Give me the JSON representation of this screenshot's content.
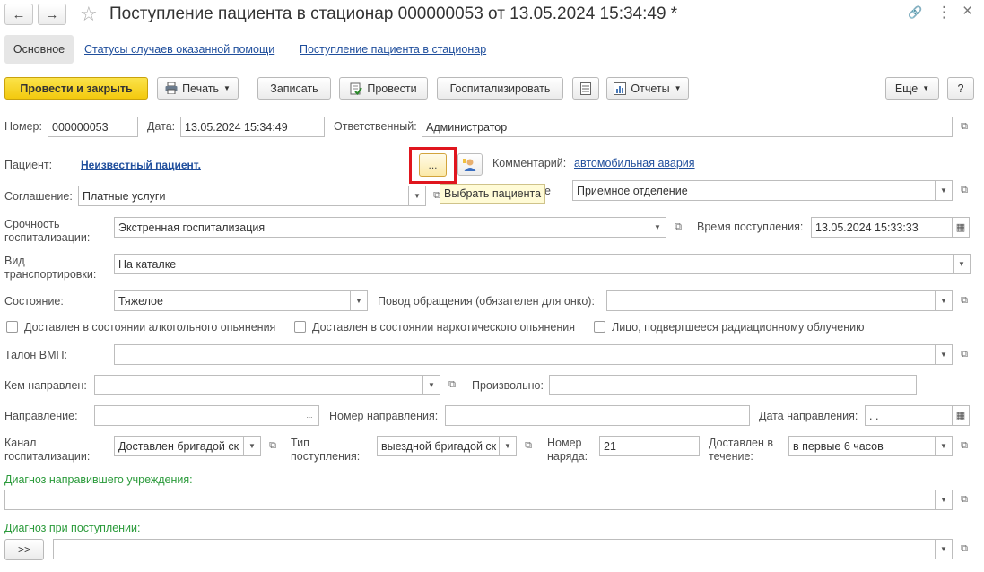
{
  "window": {
    "title": "Поступление пациента в стационар 000000053 от 13.05.2024 15:34:49 *",
    "back_glyph": "←",
    "forward_glyph": "→",
    "star_glyph": "☆",
    "link_glyph": "🔗",
    "more_glyph": "⋮",
    "close_glyph": "×"
  },
  "tabs": {
    "main": "Основное",
    "statuses": "Статусы случаев оказанной помощи",
    "admission": "Поступление пациента в стационар"
  },
  "toolbar": {
    "post_close": "Провести и закрыть",
    "print": "Печать",
    "write": "Записать",
    "post": "Провести",
    "hospitalize": "Госпитализировать",
    "reports": "Отчеты",
    "more": "Еще",
    "help": "?"
  },
  "form": {
    "number_label": "Номер:",
    "number_value": "000000053",
    "date_label": "Дата:",
    "date_value": "13.05.2024 15:34:49",
    "responsible_label": "Ответственный:",
    "responsible_value": "Администратор",
    "patient_label": "Пациент:",
    "patient_value": "Неизвестный пациент.",
    "select_button": "...",
    "tooltip": "Выбрать пациента",
    "comment_label": "Комментарий:",
    "comment_value": "автомобильная авария",
    "agreement_label": "Соглашение:",
    "agreement_value": "Платные услуги",
    "department_label_tail": "е",
    "department_value": "Приемное отделение",
    "urgency_label_1": "Срочность",
    "urgency_label_2": "госпитализации:",
    "urgency_value": "Экстренная госпитализация",
    "arrival_time_label": "Время поступления:",
    "arrival_time_value": "13.05.2024 15:33:33",
    "transport_label_1": "Вид",
    "transport_label_2": "транспортировки:",
    "transport_value": "На каталке",
    "condition_label": "Состояние:",
    "condition_value": "Тяжелое",
    "reason_label": "Повод обращения (обязателен для онко):",
    "reason_value": "",
    "chk_alcohol": "Доставлен в состоянии алкогольного опьянения",
    "chk_drugs": "Доставлен в состоянии наркотического опьянения",
    "chk_radiation": "Лицо, подвергшееся радиационному облучению",
    "vmp_label": "Талон ВМП:",
    "vmp_value": "",
    "referred_by_label": "Кем направлен:",
    "referred_by_value": "",
    "arbitrary_label": "Произвольно:",
    "arbitrary_value": "",
    "direction_label": "Направление:",
    "direction_value": "",
    "direction_number_label": "Номер направления:",
    "direction_number_value": "",
    "direction_date_label": "Дата направления:",
    "direction_date_value": " .  .",
    "channel_label_1": "Канал",
    "channel_label_2": "госпитализации:",
    "channel_value": "Доставлен бригадой ск",
    "admission_type_label_1": "Тип",
    "admission_type_label_2": "поступления:",
    "admission_type_value": "выездной бригадой ск",
    "order_number_label_1": "Номер",
    "order_number_label_2": "наряда:",
    "order_number_value": "21",
    "delivered_within_label_1": "Доставлен в",
    "delivered_within_label_2": "течение:",
    "delivered_within_value": "в первые  6 часов",
    "referring_diagnosis_label": "Диагноз направившего учреждения:",
    "referring_diagnosis_value": "",
    "admission_diagnosis_label": "Диагноз при поступлении:",
    "admission_diagnosis_value": "",
    "expand_button": ">>"
  },
  "colors": {
    "accent_yellow": "#f3c90e",
    "link_blue": "#1f4e9c",
    "highlight_red": "#e0161e",
    "label_green": "#2a9a3a"
  }
}
